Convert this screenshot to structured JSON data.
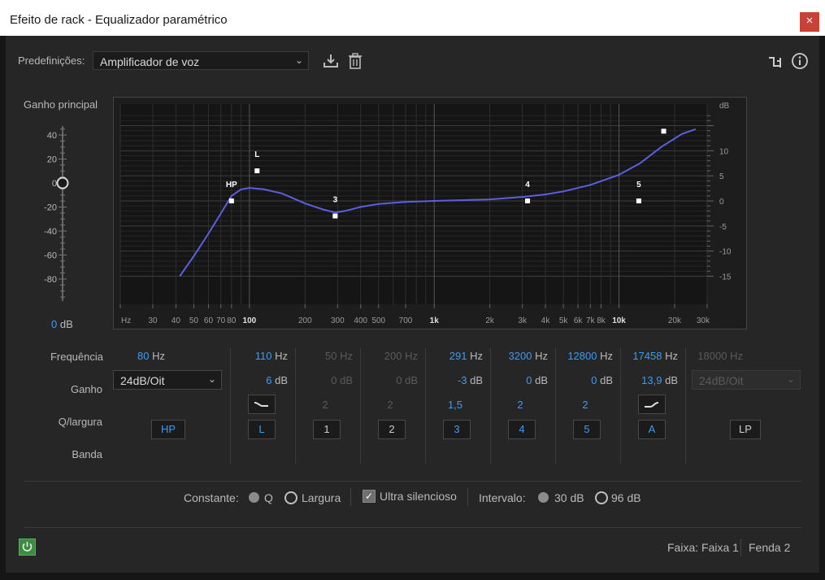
{
  "window": {
    "title": "Efeito de rack - Equalizador paramétrico",
    "close_glyph": "×"
  },
  "toolbar": {
    "presets_label": "Predefinições:",
    "preset_value": "Amplificador de voz",
    "icons": [
      "save-preset-icon",
      "trash-icon",
      "routing-icon",
      "info-icon"
    ]
  },
  "master_gain": {
    "label": "Ganho principal",
    "ticks": [
      "40",
      "20",
      "0",
      "-20",
      "-40",
      "-60",
      "-80"
    ],
    "value": "0",
    "unit": "dB",
    "slider_level_db": 0
  },
  "graph": {
    "freq_ticks": [
      "Hz",
      "30",
      "40",
      "50",
      "60",
      "70",
      "80",
      "100",
      "200",
      "300",
      "400",
      "500",
      "700",
      "1k",
      "2k",
      "3k",
      "4k",
      "5k",
      "6k",
      "7k",
      "8k",
      "10k",
      "20k",
      "30k"
    ],
    "db_unit": "dB",
    "db_ticks": [
      "10",
      "5",
      "0",
      "-5",
      "-10",
      "-15"
    ],
    "markers": [
      {
        "label": "HP",
        "freq_hz": 80,
        "gain_db": 0
      },
      {
        "label": "L",
        "freq_hz": 110,
        "gain_db": 6
      },
      {
        "label": "3",
        "freq_hz": 291,
        "gain_db": -3
      },
      {
        "label": "4",
        "freq_hz": 3200,
        "gain_db": 0
      },
      {
        "label": "5",
        "freq_hz": 12800,
        "gain_db": 0
      },
      {
        "label": "",
        "freq_hz": 17458,
        "gain_db": 13.9
      }
    ],
    "curve_color": "#5b5fe0"
  },
  "row_labels": {
    "frequency": "Frequência",
    "gain": "Ganho",
    "q_width": "Q/largura",
    "band": "Banda"
  },
  "bands": {
    "hp": {
      "freq": "80",
      "unit": "Hz",
      "slope": "24dB/Oit",
      "band": "HP"
    },
    "l": {
      "freq": "110",
      "unit": "Hz",
      "gain": "6",
      "gain_unit": "dB",
      "q_shape": "low-shelf-icon",
      "band": "L"
    },
    "b1": {
      "freq": "50",
      "unit": "Hz",
      "gain": "0",
      "gain_unit": "dB",
      "q": "2",
      "band": "1"
    },
    "b2": {
      "freq": "200",
      "unit": "Hz",
      "gain": "0",
      "gain_unit": "dB",
      "q": "2",
      "band": "2"
    },
    "b3": {
      "freq": "291",
      "unit": "Hz",
      "gain": "-3",
      "gain_unit": "dB",
      "q": "1,5",
      "band": "3"
    },
    "b4": {
      "freq": "3200",
      "unit": "Hz",
      "gain": "0",
      "gain_unit": "dB",
      "q": "2",
      "band": "4"
    },
    "b5": {
      "freq": "12800",
      "unit": "Hz",
      "gain": "0",
      "gain_unit": "dB",
      "q": "2",
      "band": "5"
    },
    "a": {
      "freq": "17458",
      "unit": "Hz",
      "gain": "13,9",
      "gain_unit": "dB",
      "q_shape": "high-shelf-icon",
      "band": "A"
    },
    "lp": {
      "freq": "18000",
      "unit": "Hz",
      "slope": "24dB/Oit",
      "band": "LP"
    }
  },
  "options": {
    "constant_label": "Constante:",
    "q_label": "Q",
    "width_label": "Largura",
    "constant_selected": "Q",
    "ultra_quiet_label": "Ultra silencioso",
    "ultra_quiet_checked": true,
    "range_label": "Intervalo:",
    "range_30": "30 dB",
    "range_96": "96 dB",
    "range_selected": "30 dB"
  },
  "footer": {
    "track": "Faixa: Faixa 1",
    "source": "Fenda 2"
  },
  "colors": {
    "accent_blue": "#3f9bf0",
    "power_green": "#3c8a43",
    "close_red": "#c8423a"
  }
}
